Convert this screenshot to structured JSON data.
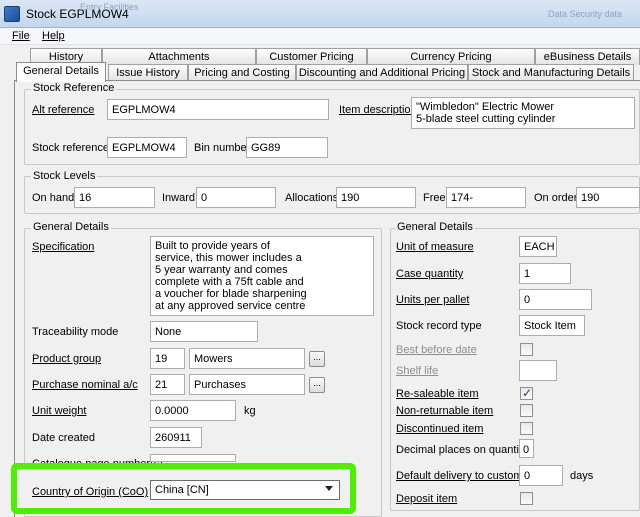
{
  "window": {
    "title": "Stock EGPLMOW4",
    "ghost_left": "Entry Facilities",
    "ghost_right": "Data Security data"
  },
  "menu": {
    "file": "File",
    "help": "Help"
  },
  "tabs_back": [
    "History",
    "Attachments",
    "Customer Pricing",
    "Currency Pricing",
    "eBusiness Details"
  ],
  "tabs_front": [
    "General Details",
    "Issue History",
    "Pricing and Costing",
    "Discounting and Additional Pricing",
    "Stock and Manufacturing Details"
  ],
  "stock_reference": {
    "legend": "Stock Reference",
    "alt_reference_label": "Alt reference",
    "alt_reference_value": "EGPLMOW4",
    "item_description_label": "Item description",
    "item_description_value": "\"Wimbledon\" Electric Mower\n5-blade steel cutting cylinder",
    "stock_reference_label": "Stock reference",
    "stock_reference_value": "EGPLMOW4",
    "bin_number_label": "Bin number",
    "bin_number_value": "GG89"
  },
  "stock_levels": {
    "legend": "Stock Levels",
    "on_hand_label": "On hand",
    "on_hand_value": "16",
    "inward_label": "Inward",
    "inward_value": "0",
    "allocations_label": "Allocations",
    "allocations_value": "190",
    "free_label": "Free",
    "free_value": "174-",
    "on_order_label": "On order",
    "on_order_value": "190"
  },
  "general_left": {
    "legend": "General Details",
    "specification_label": "Specification",
    "specification_value": "Built to provide years of\nservice, this mower includes a\n5 year warranty and comes\ncomplete with a 75ft cable and\na voucher for blade sharpening\nat any approved service centre",
    "traceability_label": "Traceability mode",
    "traceability_value": "None",
    "product_group_label": "Product group",
    "product_group_code": "19",
    "product_group_name": "Mowers",
    "purchase_nominal_label": "Purchase nominal a/c",
    "purchase_nominal_code": "21",
    "purchase_nominal_name": "Purchases",
    "unit_weight_label": "Unit weight",
    "unit_weight_value": "0.0000",
    "unit_weight_unit": "kg",
    "date_created_label": "Date created",
    "date_created_value": "260911",
    "catalogue_label": "Catalogue page number(s)",
    "country_label": "Country of Origin (CoO)",
    "country_value": "China [CN]",
    "dots": "..."
  },
  "general_right": {
    "legend": "General Details",
    "unit_of_measure_label": "Unit of measure",
    "unit_of_measure_value": "EACH",
    "case_quantity_label": "Case quantity",
    "case_quantity_value": "1",
    "units_per_pallet_label": "Units per pallet",
    "units_per_pallet_value": "0",
    "stock_record_type_label": "Stock record type",
    "stock_record_type_value": "Stock Item",
    "best_before_label": "Best before date",
    "shelf_life_label": "Shelf life",
    "resaleable_label": "Re-saleable item",
    "non_returnable_label": "Non-returnable item",
    "discontinued_label": "Discontinued item",
    "decimal_places_label": "Decimal places on quantity",
    "decimal_places_value": "0",
    "default_delivery_label": "Default delivery to customer",
    "default_delivery_value": "0",
    "default_delivery_unit": "days",
    "deposit_label": "Deposit item",
    "resaleable_checked": true,
    "non_returnable_checked": false,
    "discontinued_checked": false,
    "deposit_checked": false,
    "best_before_checked": false
  }
}
